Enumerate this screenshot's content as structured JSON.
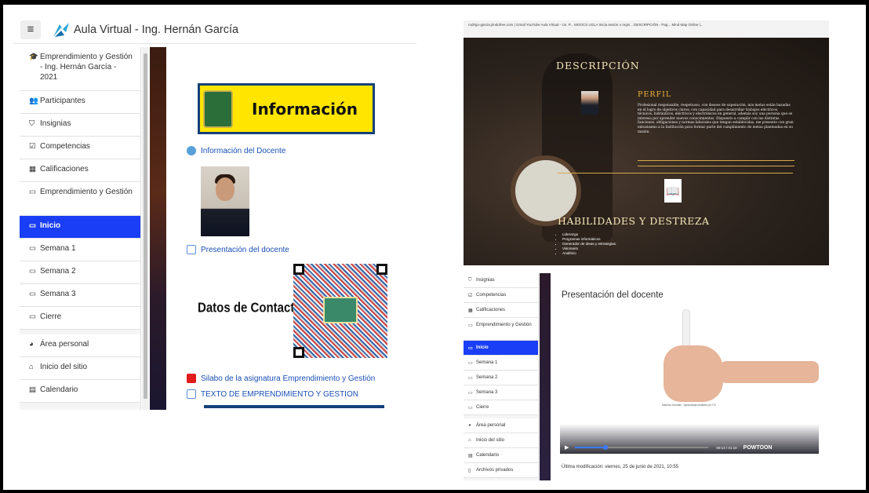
{
  "left": {
    "site_title": "Aula Virtual - Ing. Hernán García",
    "nav": [
      {
        "label": "Emprendimiento y Gestión - Ing. Hernán García - 2021",
        "icon": "graduation-cap-icon",
        "glyph": "🎓"
      },
      {
        "label": "Participantes",
        "icon": "users-icon",
        "glyph": "👥"
      },
      {
        "label": "Insignias",
        "icon": "shield-icon",
        "glyph": "⛉"
      },
      {
        "label": "Competencias",
        "icon": "checkbox-icon",
        "glyph": "☑"
      },
      {
        "label": "Calificaciones",
        "icon": "table-icon",
        "glyph": "▦"
      },
      {
        "label": "Emprendimiento y Gestión",
        "icon": "folder-icon",
        "glyph": "▭"
      },
      {
        "label": "Inicio",
        "icon": "folder-icon",
        "glyph": "▭"
      },
      {
        "label": "Semana 1",
        "icon": "folder-icon",
        "glyph": "▭"
      },
      {
        "label": "Semana 2",
        "icon": "folder-icon",
        "glyph": "▭"
      },
      {
        "label": "Semana 3",
        "icon": "folder-icon",
        "glyph": "▭"
      },
      {
        "label": "Cierre",
        "icon": "folder-icon",
        "glyph": "▭"
      },
      {
        "label": "Área personal",
        "icon": "dashboard-icon",
        "glyph": "◕"
      },
      {
        "label": "Inicio del sitio",
        "icon": "home-icon",
        "glyph": "⌂"
      },
      {
        "label": "Calendario",
        "icon": "calendar-icon",
        "glyph": "▤"
      }
    ],
    "banner_text": "Información",
    "links": {
      "docente_info": "Información del Docente",
      "presentacion": "Presentación del docente",
      "silabo": "Silabo de la asignatura Emprendimiento y Gestión",
      "texto": "TEXTO DE EMPRENDIMIENTO Y GESTION"
    },
    "contact_label": "Datos de Contacto:"
  },
  "right_top": {
    "bookmarks": "rodrigo-garcia.jimdofree.com   |   Gmail   YouTube   Aula Virtual - Un. P...   MOOCS UGLA   Inicia sesión o regis...   DESCRIPCIÓN - Pag...   Mind Map Online |...",
    "heading_desc": "DESCRIPCIÓN",
    "heading_perfil": "PERFIL",
    "perfil_text": "Profesional responsable, respetuoso, con deseos de superación, mis metas están basadas en el logro de objetivos claros; con capacidad para desarrollar trabajos eléctricos, técnicos, hidráulicos, eléctricos y electrónicos en general, además soy una persona que se interesa por aprender nuevos conocimientos. Dispuesto a cumplir con las distintas funciones, obligaciones y normas laborales que tengan establecidas, me presento con gran entusiasmo a la Institución para formar parte del cumplimiento de metas planteadas en su misión.",
    "heading_hab": "HABILIDADES Y DESTREZA",
    "skills": [
      "Liderazgo",
      "Programas informáticos",
      "Generador de ideas y estrategias.",
      "Visionario",
      "Analítico"
    ]
  },
  "right_bottom": {
    "nav": [
      {
        "label": "Insignias",
        "glyph": "⛉",
        "icon": "shield-icon"
      },
      {
        "label": "Competencias",
        "glyph": "☑",
        "icon": "checkbox-icon"
      },
      {
        "label": "Calificaciones",
        "glyph": "▦",
        "icon": "table-icon"
      },
      {
        "label": "Emprendimiento y Gestión",
        "glyph": "▭",
        "icon": "folder-icon"
      },
      {
        "label": "Inicio",
        "glyph": "▭",
        "icon": "folder-icon"
      },
      {
        "label": "Semana 1",
        "glyph": "▭",
        "icon": "folder-icon"
      },
      {
        "label": "Semana 2",
        "glyph": "▭",
        "icon": "folder-icon"
      },
      {
        "label": "Semana 3",
        "glyph": "▭",
        "icon": "folder-icon"
      },
      {
        "label": "Cierre",
        "glyph": "▭",
        "icon": "folder-icon"
      },
      {
        "label": "Área personal",
        "glyph": "◕",
        "icon": "dashboard-icon"
      },
      {
        "label": "Inicio del sitio",
        "glyph": "⌂",
        "icon": "home-icon"
      },
      {
        "label": "Calendario",
        "glyph": "▤",
        "icon": "calendar-icon"
      },
      {
        "label": "Archivos privados",
        "glyph": "▯",
        "icon": "file-icon"
      }
    ],
    "video_title": "Presentación del docente",
    "video_caption": "Mauricio Guzmán · Aprendizaje mediado por TIC",
    "video_time": "00:13 / 01:10",
    "video_brand": "POWTOON",
    "last_modified": "Última modificación: viernes, 25 de junio de 2021, 10:55"
  },
  "colors": {
    "active": "#1a3ef5",
    "link": "#1a4fb5",
    "banner_yellow": "#ffe500",
    "banner_border": "#16417a",
    "gold": "#f1b63a"
  }
}
